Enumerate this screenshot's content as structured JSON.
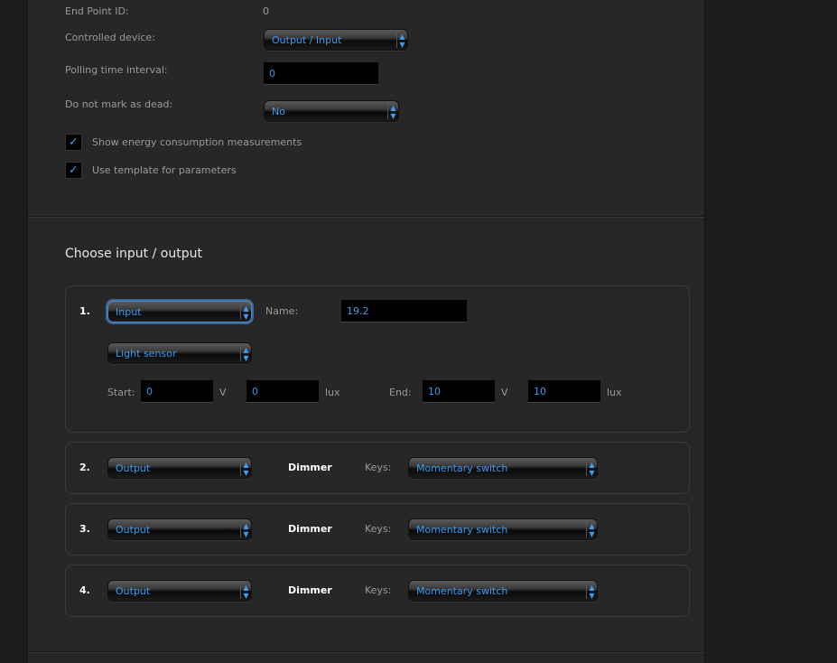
{
  "settings": {
    "end_point_label": "End Point ID:",
    "end_point_value": "0",
    "controlled_device_label": "Controlled device:",
    "controlled_device_value": "Output / Input",
    "polling_label": "Polling time interval:",
    "polling_value": "0",
    "dead_label": "Do not mark as dead:",
    "dead_value": "No",
    "energy_label": "Show energy consumption measurements",
    "energy_checked": true,
    "template_label": "Use template for parameters",
    "template_checked": true
  },
  "io": {
    "title": "Choose input / output",
    "name_label": "Name:",
    "keys_label": "Keys:",
    "start_label": "Start:",
    "end_label": "End:",
    "unit_v": "V",
    "unit_lux": "lux",
    "channels": [
      {
        "num": "1.",
        "type": "Input",
        "name": "19.2",
        "sensor": "Light sensor",
        "start_v": "0",
        "start_lux": "0",
        "end_v": "10",
        "end_lux": "10"
      },
      {
        "num": "2.",
        "type": "Output",
        "kind": "Dimmer",
        "keys": "Momentary switch"
      },
      {
        "num": "3.",
        "type": "Output",
        "kind": "Dimmer",
        "keys": "Momentary switch"
      },
      {
        "num": "4.",
        "type": "Output",
        "kind": "Dimmer",
        "keys": "Momentary switch"
      }
    ]
  }
}
